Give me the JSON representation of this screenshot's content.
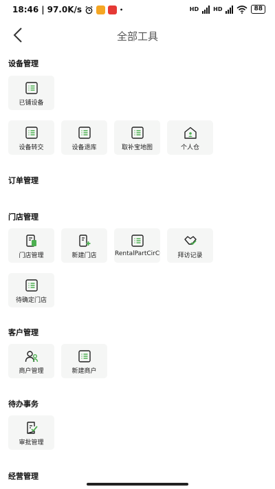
{
  "status_bar": {
    "time": "18:46",
    "net_speed": "97.0K/s",
    "network_1": "HD",
    "network_2": "HD",
    "battery": "88"
  },
  "header": {
    "title": "全部工具"
  },
  "sections": {
    "device": {
      "title": "设备管理",
      "items": [
        {
          "label": "已铺设备",
          "icon": "list-icon"
        },
        {
          "label": "设备转交",
          "icon": "list-icon"
        },
        {
          "label": "设备退库",
          "icon": "list-icon"
        },
        {
          "label": "取补宝地图",
          "icon": "list-icon"
        },
        {
          "label": "个人仓",
          "icon": "warehouse-icon"
        }
      ]
    },
    "order": {
      "title": "订单管理"
    },
    "store": {
      "title": "门店管理",
      "items": [
        {
          "label": "门店管理",
          "icon": "store-icon"
        },
        {
          "label": "新建门店",
          "icon": "new-store-icon"
        },
        {
          "label": "RentalPartCirCula",
          "icon": "list-icon"
        },
        {
          "label": "拜访记录",
          "icon": "handshake-icon"
        },
        {
          "label": "待确定门店",
          "icon": "list-icon"
        }
      ]
    },
    "customer": {
      "title": "客户管理",
      "items": [
        {
          "label": "商户管理",
          "icon": "users-icon"
        },
        {
          "label": "新建商户",
          "icon": "list-icon"
        }
      ]
    },
    "todo": {
      "title": "待办事务",
      "items": [
        {
          "label": "审批管理",
          "icon": "approval-icon"
        }
      ]
    },
    "business": {
      "title": "经营管理"
    }
  },
  "colors": {
    "accent": "#4caf50",
    "tile_bg": "#f5f6f5",
    "icon_stroke": "#222222"
  }
}
